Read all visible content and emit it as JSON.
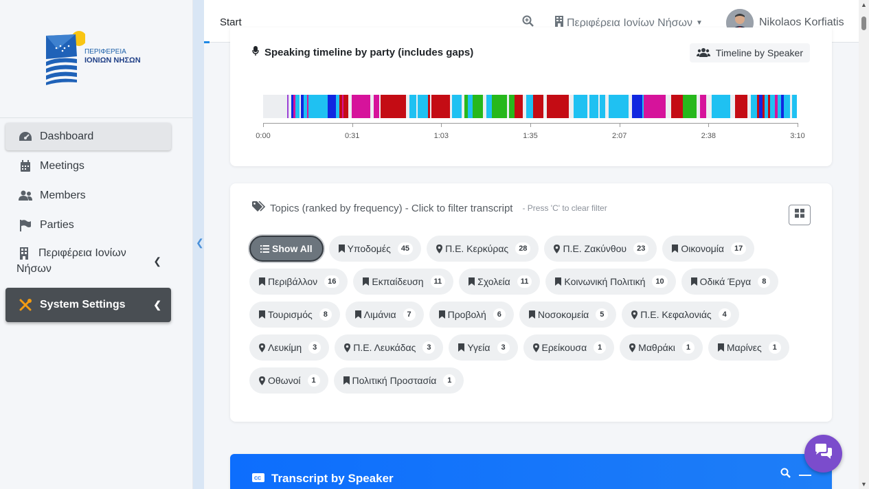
{
  "brand": {
    "logo_line1": "ΠΕΡΙΦΕΡΕΙΑ",
    "logo_line2": "ΙΟΝΙΩΝ ΝΗΣΩΝ"
  },
  "sidebar": {
    "items": [
      {
        "label": "Dashboard",
        "icon": "tachometer-icon",
        "active": true
      },
      {
        "label": "Meetings",
        "icon": "calendar-icon"
      },
      {
        "label": "Members",
        "icon": "users-icon"
      },
      {
        "label": "Parties",
        "icon": "flag-icon"
      },
      {
        "label": "Περιφέρεια Ιονίων Νήσων",
        "icon": "building-icon"
      },
      {
        "label": "System Settings",
        "icon": "tools-icon"
      }
    ]
  },
  "topbar": {
    "start_label": "Start",
    "region_label": "Περιφέρεια Ιονίων Νήσων",
    "user_name": "Nikolaos Korfiatis"
  },
  "timeline": {
    "title": "Speaking timeline by party (includes gaps)",
    "speaker_button": "Timeline by Speaker",
    "ticks": [
      "0:00",
      "0:31",
      "1:03",
      "1:35",
      "2:07",
      "2:38",
      "3:10"
    ],
    "colors": {
      "gap": "#eceef1",
      "cyan": "#1fc1f2",
      "blue": "#1127e0",
      "magenta": "#d6139b",
      "red": "#c40c14",
      "green": "#27b81c",
      "purple": "#9b3fd6"
    }
  },
  "topics": {
    "title": "Topics (ranked by frequency) - Click to filter transcript",
    "hint": "- Press 'C' to clear filter",
    "show_all": "Show All",
    "chips": [
      {
        "label": "Υποδομές",
        "count": "45",
        "icon": "bookmark-icon"
      },
      {
        "label": "Π.Ε. Κερκύρας",
        "count": "28",
        "icon": "map-marker-icon"
      },
      {
        "label": "Π.Ε. Ζακύνθου",
        "count": "23",
        "icon": "map-marker-icon"
      },
      {
        "label": "Οικονομία",
        "count": "17",
        "icon": "bookmark-icon"
      },
      {
        "label": "Περιβάλλον",
        "count": "16",
        "icon": "bookmark-icon"
      },
      {
        "label": "Εκπαίδευση",
        "count": "11",
        "icon": "bookmark-icon"
      },
      {
        "label": "Σχολεία",
        "count": "11",
        "icon": "bookmark-icon"
      },
      {
        "label": "Κοινωνική Πολιτική",
        "count": "10",
        "icon": "bookmark-icon"
      },
      {
        "label": "Οδικά Έργα",
        "count": "8",
        "icon": "bookmark-icon"
      },
      {
        "label": "Τουρισμός",
        "count": "8",
        "icon": "bookmark-icon"
      },
      {
        "label": "Λιμάνια",
        "count": "7",
        "icon": "bookmark-icon"
      },
      {
        "label": "Προβολή",
        "count": "6",
        "icon": "bookmark-icon"
      },
      {
        "label": "Νοσοκομεία",
        "count": "5",
        "icon": "bookmark-icon"
      },
      {
        "label": "Π.Ε. Κεφαλονιάς",
        "count": "4",
        "icon": "map-marker-icon"
      },
      {
        "label": "Λευκίμη",
        "count": "3",
        "icon": "map-marker-icon"
      },
      {
        "label": "Π.Ε. Λευκάδας",
        "count": "3",
        "icon": "map-marker-icon"
      },
      {
        "label": "Υγεία",
        "count": "3",
        "icon": "bookmark-icon"
      },
      {
        "label": "Ερείκουσα",
        "count": "1",
        "icon": "map-marker-icon"
      },
      {
        "label": "Μαθράκι",
        "count": "1",
        "icon": "map-marker-icon"
      },
      {
        "label": "Μαρίνες",
        "count": "1",
        "icon": "bookmark-icon"
      },
      {
        "label": "Οθωνοί",
        "count": "1",
        "icon": "map-marker-icon"
      },
      {
        "label": "Πολιτική Προστασία",
        "count": "1",
        "icon": "bookmark-icon"
      }
    ]
  },
  "transcript": {
    "title": "Transcript by Speaker"
  }
}
